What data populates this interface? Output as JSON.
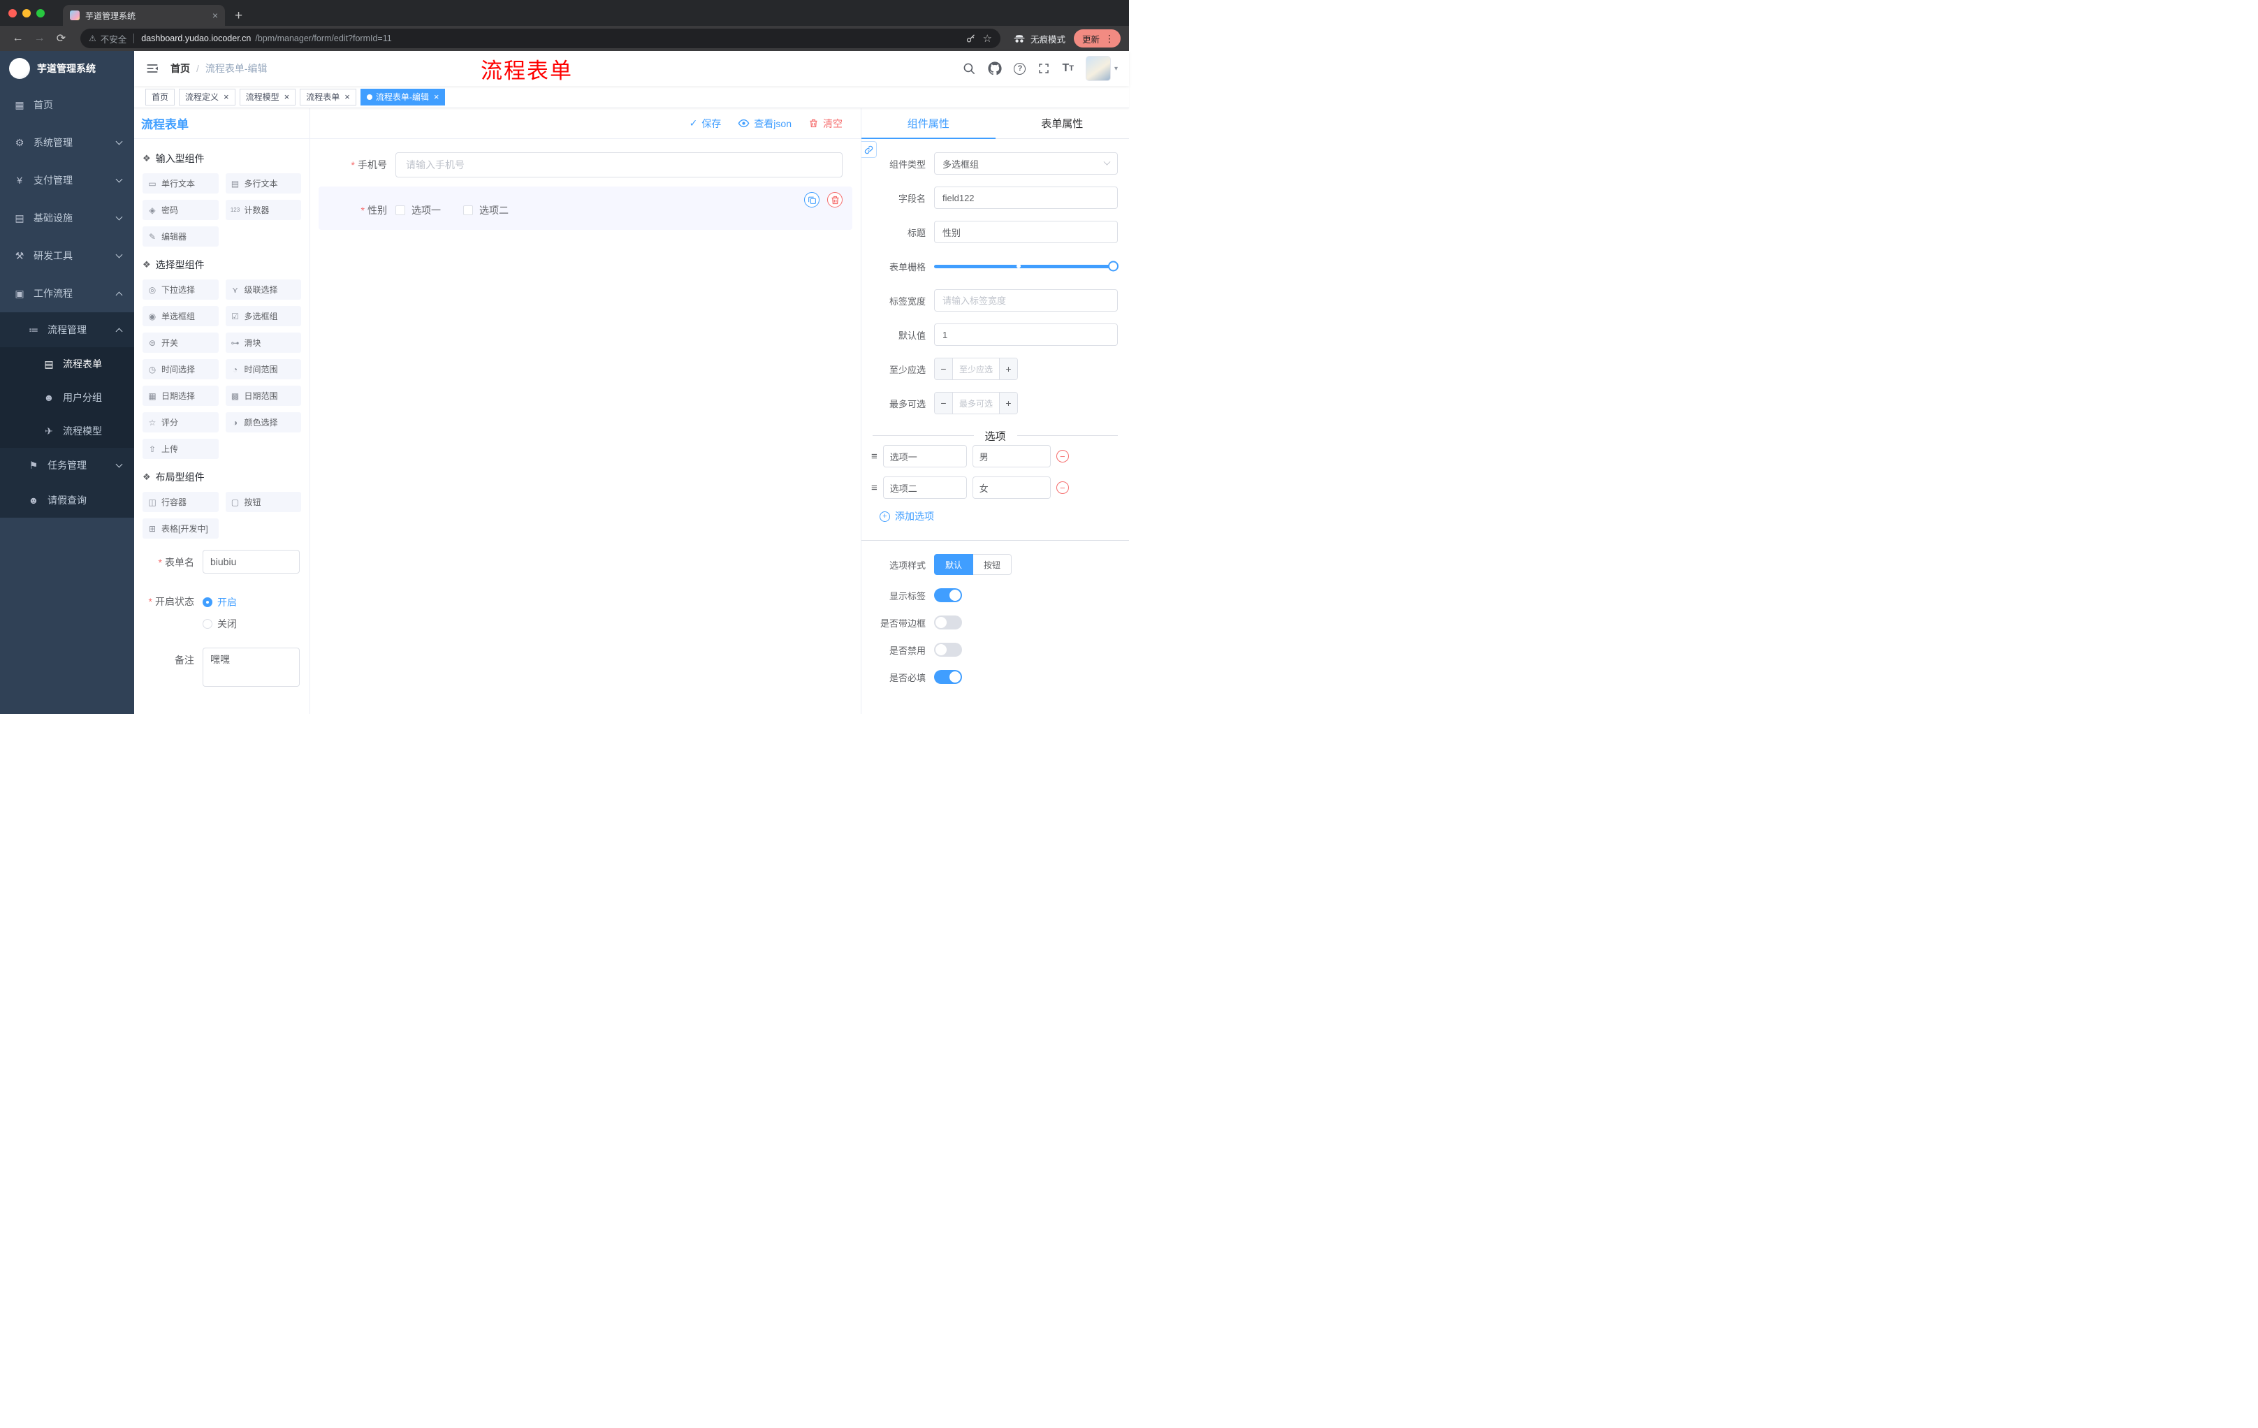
{
  "annotation": {
    "text": "流程表单",
    "color": "#fe0000"
  },
  "browser": {
    "tab_title": "芋道管理系统",
    "security": "不安全",
    "host": "dashboard.yudao.iocoder.cn",
    "path": "/bpm/manager/form/edit?formId=11",
    "incognito": "无痕模式",
    "update": "更新"
  },
  "sidebar": {
    "title": "芋道管理系统",
    "menu": [
      {
        "key": "home",
        "label": "首页",
        "icon": "dashboard-icon",
        "arrow": ""
      },
      {
        "key": "system-management",
        "label": "系统管理",
        "icon": "gear-icon",
        "arrow": "down"
      },
      {
        "key": "payment-management",
        "label": "支付管理",
        "icon": "payment-icon",
        "arrow": "down"
      },
      {
        "key": "infrastructure",
        "label": "基础设施",
        "icon": "infra-icon",
        "arrow": "down"
      },
      {
        "key": "dev-tools",
        "label": "研发工具",
        "icon": "tools-icon",
        "arrow": "down"
      },
      {
        "key": "workflow",
        "label": "工作流程",
        "icon": "workflow-icon",
        "arrow": "up"
      }
    ],
    "submenu": [
      {
        "key": "process-management",
        "label": "流程管理",
        "icon": "process-icon",
        "arrow": "up",
        "level": 1,
        "active": false
      },
      {
        "key": "process-form",
        "label": "流程表单",
        "icon": "form-icon",
        "arrow": "",
        "level": 2,
        "active": true
      },
      {
        "key": "user-group",
        "label": "用户分组",
        "icon": "group-icon",
        "arrow": "",
        "level": 2,
        "active": false
      },
      {
        "key": "process-model",
        "label": "流程模型",
        "icon": "model-icon",
        "arrow": "",
        "level": 2,
        "active": false
      },
      {
        "key": "task-management",
        "label": "任务管理",
        "icon": "task-icon",
        "arrow": "down",
        "level": 1,
        "active": false
      },
      {
        "key": "leave-query",
        "label": "请假查询",
        "icon": "user-icon",
        "arrow": "",
        "level": 1,
        "active": false
      }
    ]
  },
  "navbar": {
    "breadcrumb": [
      "首页",
      "流程表单-编辑"
    ]
  },
  "tags": [
    {
      "key": "home",
      "label": "首页",
      "closable": false,
      "active": false
    },
    {
      "key": "process-definition",
      "label": "流程定义",
      "closable": true,
      "active": false
    },
    {
      "key": "process-model",
      "label": "流程模型",
      "closable": true,
      "active": false
    },
    {
      "key": "process-form",
      "label": "流程表单",
      "closable": true,
      "active": false
    },
    {
      "key": "process-form-edit",
      "label": "流程表单-编辑",
      "closable": true,
      "active": true
    }
  ],
  "designer": {
    "panel_title": "流程表单",
    "actions": [
      {
        "key": "save",
        "label": "保存",
        "icon": "check-icon",
        "color": "blue"
      },
      {
        "key": "view-json",
        "label": "查看json",
        "icon": "eye-icon",
        "color": "blue"
      },
      {
        "key": "clear",
        "label": "清空",
        "icon": "trash-icon",
        "color": "red"
      }
    ],
    "palette_groups": [
      {
        "key": "input-components",
        "title": "输入型组件",
        "items": [
          {
            "key": "single-line-text",
            "label": "单行文本",
            "icon": "text-input-icon"
          },
          {
            "key": "multi-line-text",
            "label": "多行文本",
            "icon": "textarea-icon"
          },
          {
            "key": "password",
            "label": "密码",
            "icon": "password-icon"
          },
          {
            "key": "counter",
            "label": "计数器",
            "icon": "counter-icon"
          },
          {
            "key": "editor",
            "label": "编辑器",
            "icon": "editor-icon"
          }
        ]
      },
      {
        "key": "select-components",
        "title": "选择型组件",
        "items": [
          {
            "key": "select",
            "label": "下拉选择",
            "icon": "select-icon"
          },
          {
            "key": "cascader",
            "label": "级联选择",
            "icon": "cascader-icon"
          },
          {
            "key": "radio-group",
            "label": "单选框组",
            "icon": "radio-icon"
          },
          {
            "key": "checkbox-group",
            "label": "多选框组",
            "icon": "checkbox-icon"
          },
          {
            "key": "switch",
            "label": "开关",
            "icon": "switch-icon"
          },
          {
            "key": "slider",
            "label": "滑块",
            "icon": "slider-icon"
          },
          {
            "key": "time-picker",
            "label": "时间选择",
            "icon": "time-icon"
          },
          {
            "key": "time-range",
            "label": "时间范围",
            "icon": "time-range-icon"
          },
          {
            "key": "date-picker",
            "label": "日期选择",
            "icon": "date-icon"
          },
          {
            "key": "date-range",
            "label": "日期范围",
            "icon": "date-range-icon"
          },
          {
            "key": "rate",
            "label": "评分",
            "icon": "rate-icon"
          },
          {
            "key": "color-picker",
            "label": "颜色选择",
            "icon": "color-icon"
          },
          {
            "key": "upload",
            "label": "上传",
            "icon": "upload-icon"
          }
        ]
      },
      {
        "key": "layout-components",
        "title": "布局型组件",
        "items": [
          {
            "key": "row-container",
            "label": "行容器",
            "icon": "row-icon"
          },
          {
            "key": "button",
            "label": "按钮",
            "icon": "button-icon"
          },
          {
            "key": "table",
            "label": "表格[开发中]",
            "icon": "table-icon"
          }
        ]
      }
    ],
    "meta_fields": [
      {
        "key": "form-name",
        "label": "表单名",
        "required": true,
        "control": "input",
        "value": "biubiu"
      },
      {
        "key": "status",
        "label": "开启状态",
        "required": true,
        "control": "radio",
        "options": [
          "开启",
          "关闭"
        ],
        "selected": "开启"
      },
      {
        "key": "remark",
        "label": "备注",
        "required": false,
        "control": "textarea",
        "value": "嘿嘿"
      }
    ],
    "canvas_fields": [
      {
        "key": "mobile",
        "type": "input",
        "label": "手机号",
        "required": true,
        "placeholder": "请输入手机号",
        "selected": false
      },
      {
        "key": "gender",
        "type": "checkbox-group",
        "label": "性别",
        "required": true,
        "selected": true,
        "options": [
          {
            "label": "选项一",
            "checked": false
          },
          {
            "label": "选项二",
            "checked": false
          }
        ]
      }
    ],
    "props": {
      "tabs": [
        {
          "key": "component-props",
          "label": "组件属性",
          "active": true
        },
        {
          "key": "form-props",
          "label": "表单属性",
          "active": false
        }
      ],
      "rows": [
        {
          "key": "component-type",
          "label": "组件类型",
          "control": "select",
          "value": "多选框组"
        },
        {
          "key": "field-name",
          "label": "字段名",
          "control": "input",
          "value": "field122"
        },
        {
          "key": "title",
          "label": "标题",
          "control": "input",
          "value": "性别"
        },
        {
          "key": "form-grid",
          "label": "表单栅格",
          "control": "slider",
          "value": 24,
          "max": 24
        },
        {
          "key": "label-width",
          "label": "标签宽度",
          "control": "input",
          "value": "",
          "placeholder": "请输入标签宽度"
        },
        {
          "key": "default-value",
          "label": "默认值",
          "control": "input",
          "value": "1"
        },
        {
          "key": "min-select",
          "label": "至少应选",
          "control": "number",
          "placeholder": "至少应选"
        },
        {
          "key": "max-select",
          "label": "最多可选",
          "control": "number",
          "placeholder": "最多可选"
        }
      ],
      "options_section": {
        "divider_label": "选项",
        "rows": [
          {
            "name": "选项一",
            "value": "男"
          },
          {
            "name": "选项二",
            "value": "女"
          }
        ],
        "add_label": "添加选项"
      },
      "style_row": {
        "key": "option-style",
        "label": "选项样式",
        "options": [
          "默认",
          "按钮"
        ],
        "selected": "默认"
      },
      "switch_rows": [
        {
          "key": "show-label",
          "label": "显示标签",
          "on": true
        },
        {
          "key": "border",
          "label": "是否带边框",
          "on": false
        },
        {
          "key": "disabled",
          "label": "是否禁用",
          "on": false
        },
        {
          "key": "required",
          "label": "是否必填",
          "on": true
        }
      ]
    }
  }
}
